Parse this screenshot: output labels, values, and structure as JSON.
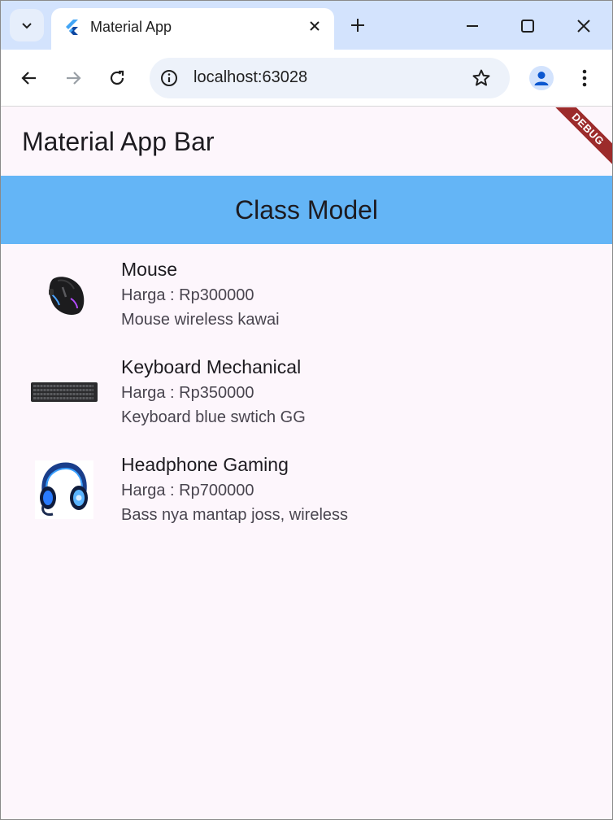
{
  "browser": {
    "tab_title": "Material App",
    "url": "localhost:63028"
  },
  "app": {
    "appbar_title": "Material App Bar",
    "debug_label": "DEBUG",
    "header_title": "Class Model"
  },
  "products": [
    {
      "name": "Mouse",
      "price": "Harga : Rp300000",
      "description": "Mouse wireless kawai",
      "image": "mouse-image"
    },
    {
      "name": "Keyboard Mechanical",
      "price": "Harga : Rp350000",
      "description": "Keyboard blue swtich GG",
      "image": "keyboard-image"
    },
    {
      "name": "Headphone Gaming",
      "price": "Harga : Rp700000",
      "description": "Bass nya mantap joss, wireless",
      "image": "headphone-image"
    }
  ],
  "colors": {
    "tabstrip": "#d3e3fd",
    "header": "#64b5f6",
    "page_bg": "#fdf6fc",
    "debug_banner": "#9c2b2b"
  }
}
